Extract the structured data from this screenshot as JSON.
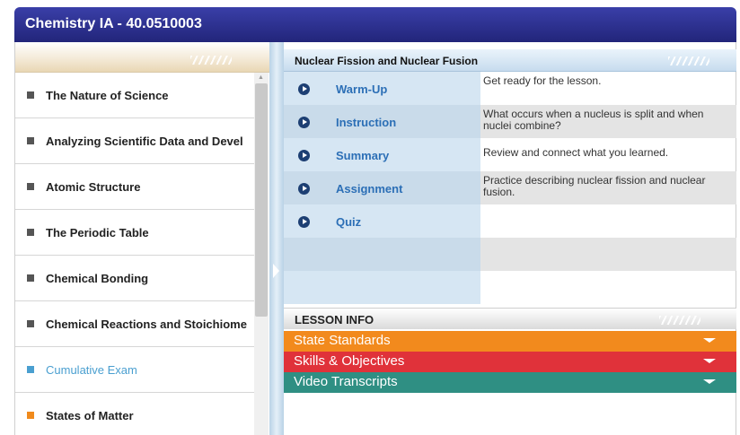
{
  "window": {
    "title": "Chemistry IA - 40.0510003"
  },
  "sidebar": {
    "units": [
      {
        "label": "The Nature of Science",
        "style": "default"
      },
      {
        "label": "Analyzing Scientific Data and Devel",
        "style": "default"
      },
      {
        "label": "Atomic Structure",
        "style": "default"
      },
      {
        "label": "The Periodic Table",
        "style": "default"
      },
      {
        "label": "Chemical Bonding",
        "style": "default"
      },
      {
        "label": "Chemical Reactions and Stoichiome",
        "style": "default"
      },
      {
        "label": "Cumulative Exam",
        "style": "blue"
      },
      {
        "label": "States of Matter",
        "style": "orange"
      }
    ]
  },
  "lesson": {
    "title": "Nuclear Fission and Nuclear Fusion",
    "steps": [
      {
        "name": "Warm-Up",
        "description": "Get ready for the lesson.",
        "icon": "play-circle-icon"
      },
      {
        "name": "Instruction",
        "description": "What occurs when a nucleus is split and when nuclei combine?",
        "icon": "play-circle-icon"
      },
      {
        "name": "Summary",
        "description": "Review and connect what you learned.",
        "icon": "play-circle-icon"
      },
      {
        "name": "Assignment",
        "description": "Practice describing nuclear fission and nuclear fusion.",
        "icon": "play-circle-icon"
      },
      {
        "name": "Quiz",
        "description": "",
        "icon": "play-circle-icon"
      }
    ]
  },
  "lesson_info": {
    "heading": "LESSON INFO",
    "sections": [
      {
        "label": "State Standards",
        "color": "#f28a1d"
      },
      {
        "label": "Skills & Objectives",
        "color": "#e0323a"
      },
      {
        "label": "Video Transcripts",
        "color": "#2f8f83"
      }
    ]
  },
  "colors": {
    "title_bar": "#2a2e8c",
    "step_link": "#2c6fb6",
    "cumulative_exam": "#4a9fd0",
    "current_unit_bullet": "#f08a1c"
  }
}
